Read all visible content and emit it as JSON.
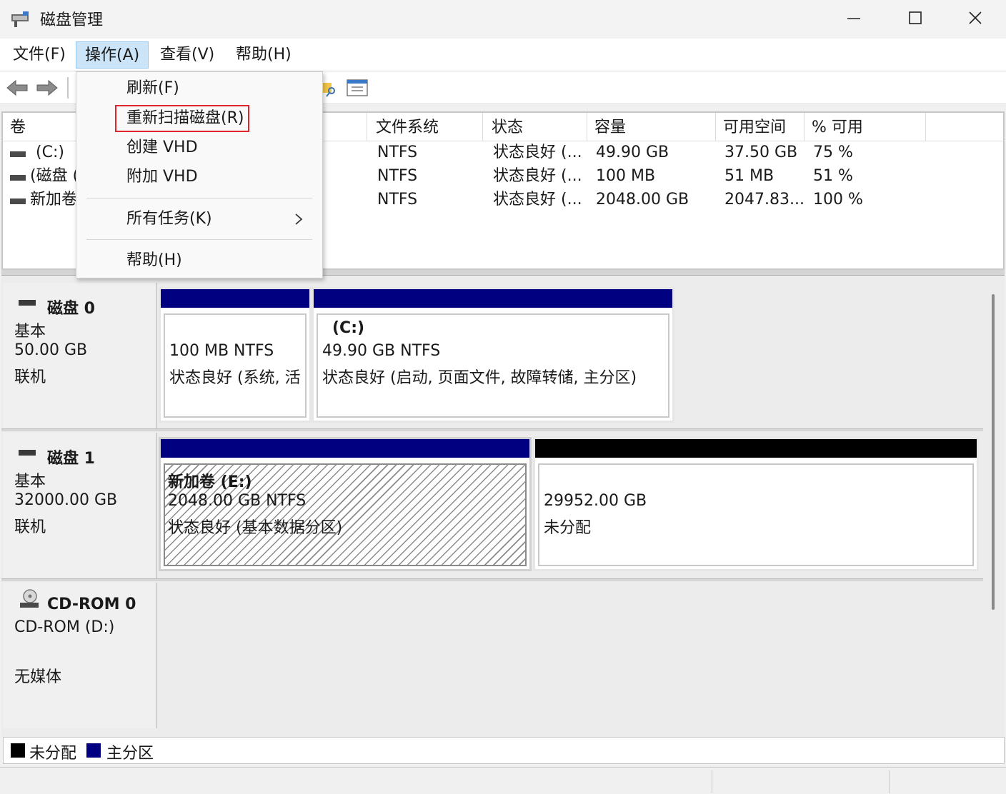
{
  "window": {
    "title": "磁盘管理"
  },
  "menubar": {
    "file": "文件(F)",
    "action": "操作(A)",
    "view": "查看(V)",
    "help": "帮助(H)"
  },
  "action_menu": {
    "refresh": "刷新(F)",
    "rescan": "重新扫描磁盘(R)",
    "create_vhd": "创建 VHD",
    "attach_vhd": "附加 VHD",
    "all_tasks": "所有任务(K)",
    "help": "帮助(H)"
  },
  "volume_list": {
    "columns": [
      "卷",
      "文件系统",
      "状态",
      "容量",
      "可用空间",
      "% 可用"
    ],
    "rows": [
      {
        "volume": "(C:)",
        "fs": "NTFS",
        "status": "状态良好 (...",
        "capacity": "49.90 GB",
        "free": "37.50 GB",
        "pct": "75 %"
      },
      {
        "volume": "(磁盘 (",
        "fs": "NTFS",
        "status": "状态良好 (...",
        "capacity": "100 MB",
        "free": "51 MB",
        "pct": "51 %"
      },
      {
        "volume": "新加卷",
        "fs": "NTFS",
        "status": "状态良好 (...",
        "capacity": "2048.00 GB",
        "free": "2047.83...",
        "pct": "100 %"
      }
    ]
  },
  "disks": [
    {
      "name": "磁盘 0",
      "type": "基本",
      "size": "50.00 GB",
      "state": "联机",
      "partitions": [
        {
          "label": "",
          "size_fs": "100 MB NTFS",
          "status": "状态良好 (系统, 活"
        },
        {
          "label": "(C:)",
          "size_fs": "49.90 GB NTFS",
          "status": "状态良好 (启动, 页面文件, 故障转储, 主分区)"
        }
      ]
    },
    {
      "name": "磁盘 1",
      "type": "基本",
      "size": "32000.00 GB",
      "state": "联机",
      "partitions": [
        {
          "label": "新加卷  (E:)",
          "size_fs": "2048.00 GB NTFS",
          "status": "状态良好 (基本数据分区)"
        },
        {
          "label": "",
          "size_fs": "29952.00 GB",
          "status": "未分配"
        }
      ]
    },
    {
      "name": "CD-ROM 0",
      "type": "CD-ROM (D:)",
      "state": "无媒体"
    }
  ],
  "legend": {
    "unallocated": "未分配",
    "primary": "主分区"
  },
  "colors": {
    "primary": "#000080",
    "unallocated": "#000000",
    "highlight_box": "#e0262c",
    "menu_active_bg": "#cce4f7"
  },
  "icons": [
    "disk-management-icon",
    "minimize-icon",
    "maximize-icon",
    "close-icon",
    "back-arrow-icon",
    "forward-arrow-icon",
    "search-folder-icon",
    "properties-icon",
    "disk-icon",
    "cdrom-icon",
    "chevron-right-icon"
  ]
}
